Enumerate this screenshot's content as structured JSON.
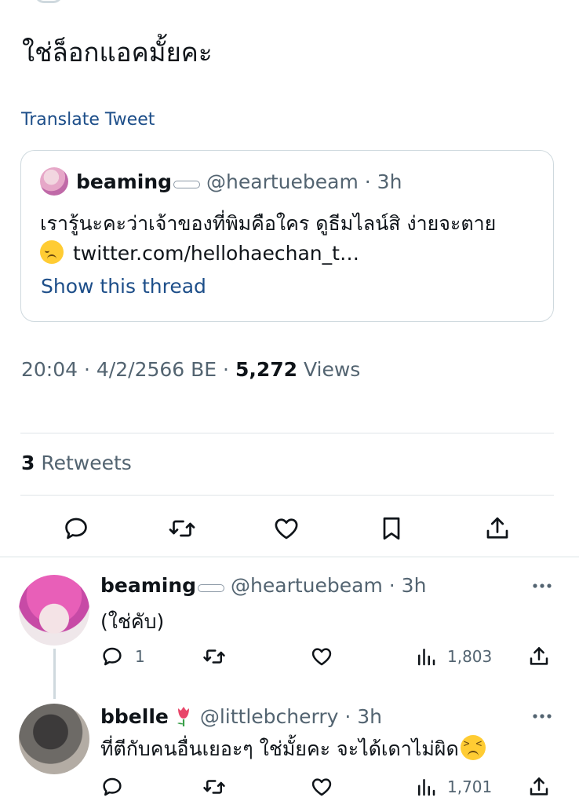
{
  "tweet": {
    "text": "ใช่ล็อกแอคมั้ยคะ",
    "translate_label": "Translate Tweet",
    "meta": {
      "time": "20:04",
      "date": "4/2/2566 BE",
      "views_count": "5,272",
      "views_label": "Views"
    },
    "retweets": {
      "count": "3",
      "label": "Retweets"
    }
  },
  "quote": {
    "name": "beaming",
    "handle": "@heartuebeam",
    "time": "3h",
    "text": "เรารู้นะคะว่าเจ้าของที่พิมคือใคร ดูธีมไลน์สิ ง่ายจะตาย",
    "link": "twitter.com/hellohaechan_t…",
    "show_thread": "Show this thread"
  },
  "actions": {
    "reply": "reply-icon",
    "retweet": "retweet-icon",
    "like": "heart-icon",
    "bookmark": "bookmark-icon",
    "share": "share-icon"
  },
  "replies": [
    {
      "name": "beaming",
      "handle": "@heartuebeam",
      "time": "3h",
      "text": "(ใช่คับ)",
      "reply_count": "1",
      "views": "1,803"
    },
    {
      "name": "bbelle",
      "handle": "@littlebcherry",
      "time": "3h",
      "text": "ที่ตีกับคนอื่นเยอะๆ ใช่มั้ยคะ จะได้เดาไม่ผิด",
      "reply_count": "",
      "views": "1,701"
    }
  ],
  "colors": {
    "link": "#1d4e89",
    "text": "#0f1419",
    "secondary": "#536471",
    "border": "#cfd9de"
  }
}
